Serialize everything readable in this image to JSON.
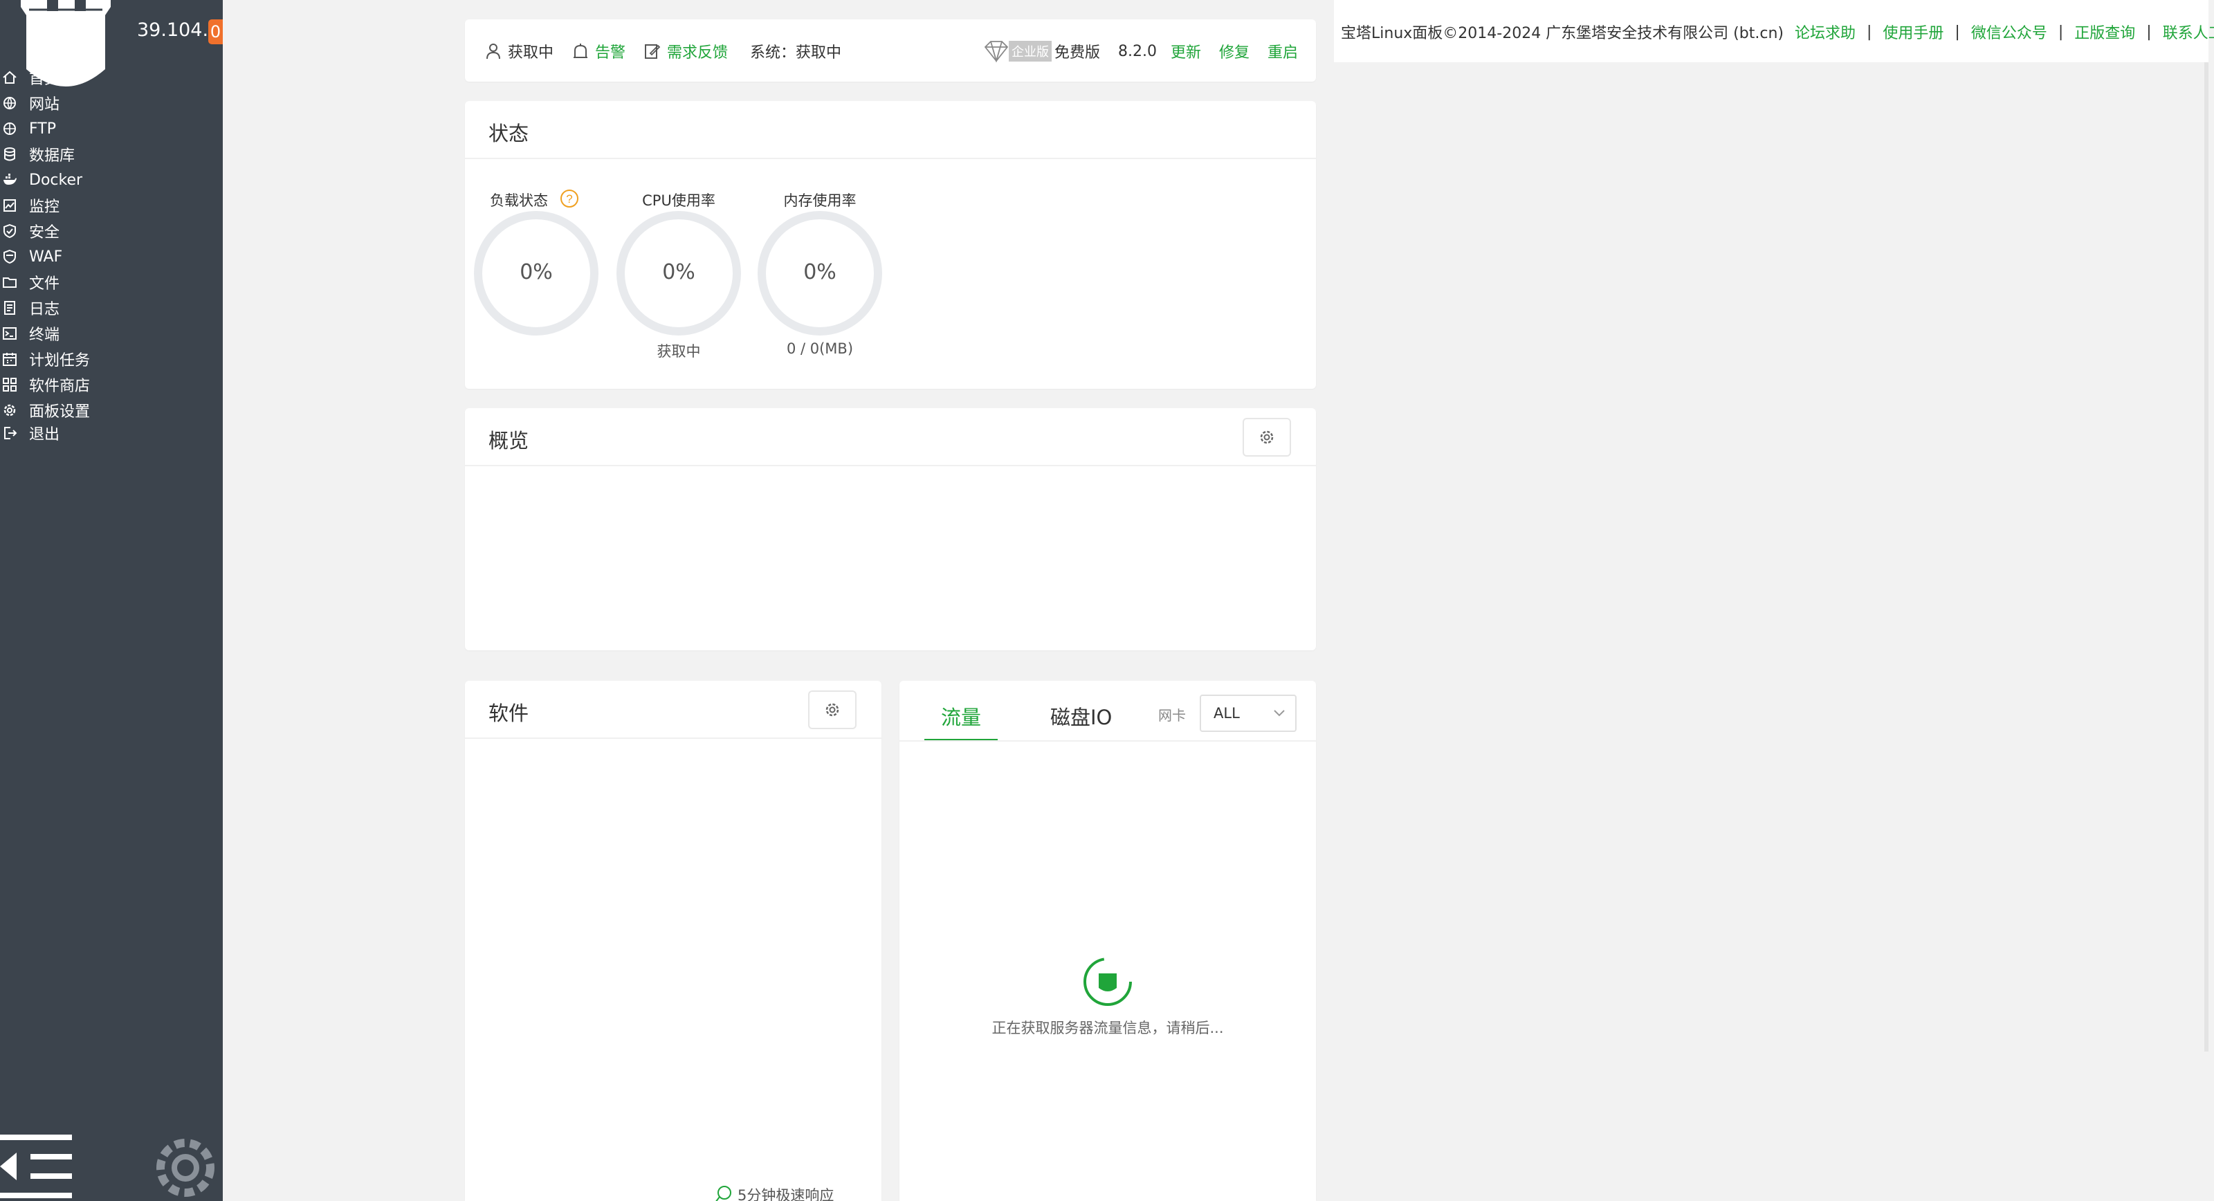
{
  "sidebar": {
    "ip": "39.104...",
    "badge": "0",
    "items": [
      {
        "label": "首页",
        "icon": "home-icon"
      },
      {
        "label": "网站",
        "icon": "globe-icon"
      },
      {
        "label": "FTP",
        "icon": "ftp-icon"
      },
      {
        "label": "数据库",
        "icon": "database-icon"
      },
      {
        "label": "Docker",
        "icon": "docker-icon"
      },
      {
        "label": "监控",
        "icon": "monitor-icon"
      },
      {
        "label": "安全",
        "icon": "shield-icon"
      },
      {
        "label": "WAF",
        "icon": "waf-icon"
      },
      {
        "label": "文件",
        "icon": "folder-icon"
      },
      {
        "label": "日志",
        "icon": "log-icon"
      },
      {
        "label": "终端",
        "icon": "terminal-icon"
      },
      {
        "label": "计划任务",
        "icon": "calendar-icon"
      },
      {
        "label": "软件商店",
        "icon": "apps-icon"
      },
      {
        "label": "面板设置",
        "icon": "gear-icon"
      },
      {
        "label": "退出",
        "icon": "logout-icon"
      }
    ]
  },
  "topbar": {
    "user": "获取中",
    "alert": "告警",
    "feedback": "需求反馈",
    "system": "系统：获取中",
    "enterprise": "企业版",
    "free": "免费版",
    "version": "8.2.0",
    "update": "更新",
    "repair": "修复",
    "restart": "重启"
  },
  "status": {
    "title": "状态",
    "gauges": [
      {
        "label": "负载状态",
        "value": "0%",
        "sub": ""
      },
      {
        "label": "CPU使用率",
        "value": "0%",
        "sub": "获取中"
      },
      {
        "label": "内存使用率",
        "value": "0%",
        "sub": "0 / 0(MB)"
      }
    ],
    "help": "?"
  },
  "overview": {
    "title": "概览"
  },
  "software": {
    "title": "软件",
    "quick_response": "5分钟极速响应"
  },
  "traffic": {
    "tabs": [
      "流量",
      "磁盘IO"
    ],
    "nic_label": "网卡",
    "nic_value": "ALL",
    "loading": "正在获取服务器流量信息，请稍后..."
  },
  "footer": {
    "copyright": "宝塔Linux面板©2014-2024 广东堡塔安全技术有限公司 (bt.cn)",
    "links": [
      "论坛求助",
      "使用手册",
      "微信公众号",
      "正版查询",
      "联系人工客服"
    ],
    "separator": "|"
  },
  "colors": {
    "accent": "#20a53a",
    "sidebar": "#3c444d",
    "badge": "#f0712c",
    "help": "#f0a020"
  }
}
